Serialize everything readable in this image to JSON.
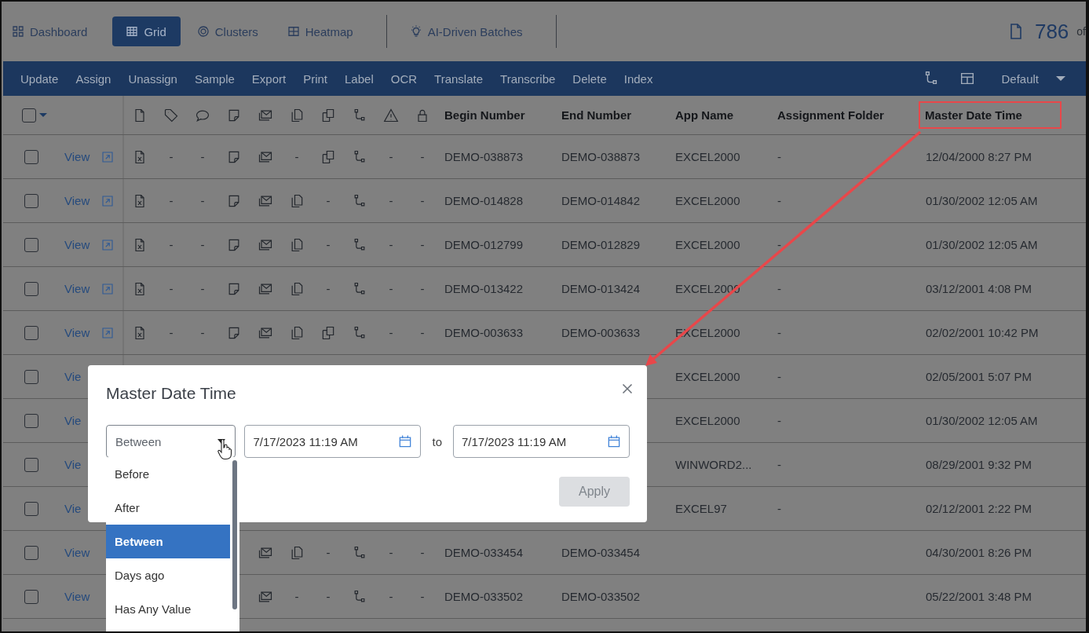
{
  "nav": {
    "tabs": [
      {
        "label": "Dashboard",
        "selected": false
      },
      {
        "label": "Grid",
        "selected": true
      },
      {
        "label": "Clusters",
        "selected": false
      },
      {
        "label": "Heatmap",
        "selected": false
      },
      {
        "label": "AI-Driven Batches",
        "selected": false
      }
    ],
    "doc_count": "786",
    "doc_count_suffix": "of"
  },
  "toolbar": {
    "actions": [
      "Update",
      "Assign",
      "Unassign",
      "Sample",
      "Export",
      "Print",
      "Label",
      "OCR",
      "Translate",
      "Transcribe",
      "Delete",
      "Index"
    ],
    "view": "Default"
  },
  "table": {
    "select_all": {
      "checked": false
    },
    "columns": [
      {
        "label": "Begin Number",
        "highlighted": false
      },
      {
        "label": "End Number",
        "highlighted": false
      },
      {
        "label": "App Name",
        "highlighted": false
      },
      {
        "label": "Assignment Folder",
        "highlighted": false
      },
      {
        "label": "Master Date Time",
        "highlighted": true
      }
    ],
    "rows": [
      {
        "checked": false,
        "view": "View",
        "link": true,
        "icons": [
          {
            "kind": "icon"
          },
          {
            "kind": "text",
            "text": "-"
          },
          {
            "kind": "text",
            "text": "-"
          },
          {
            "kind": "icon"
          },
          {
            "kind": "icon"
          },
          {
            "kind": "text",
            "text": "-"
          },
          {
            "kind": "icon"
          },
          {
            "kind": "icon"
          },
          {
            "kind": "text",
            "text": "-"
          },
          {
            "kind": "text",
            "text": "-"
          }
        ],
        "cells": [
          "DEMO-038873",
          "DEMO-038873",
          "EXCEL2000",
          "-",
          "12/04/2000 8:27 PM"
        ]
      },
      {
        "checked": false,
        "view": "View",
        "link": true,
        "icons": [
          {
            "kind": "icon"
          },
          {
            "kind": "text",
            "text": "-"
          },
          {
            "kind": "text",
            "text": "-"
          },
          {
            "kind": "icon"
          },
          {
            "kind": "icon"
          },
          {
            "kind": "icon"
          },
          {
            "kind": "text",
            "text": "-"
          },
          {
            "kind": "icon"
          },
          {
            "kind": "text",
            "text": "-"
          },
          {
            "kind": "text",
            "text": "-"
          }
        ],
        "cells": [
          "DEMO-014828",
          "DEMO-014842",
          "EXCEL2000",
          "-",
          "01/30/2002 12:05 AM"
        ]
      },
      {
        "checked": false,
        "view": "View",
        "link": true,
        "icons": [
          {
            "kind": "icon"
          },
          {
            "kind": "text",
            "text": "-"
          },
          {
            "kind": "text",
            "text": "-"
          },
          {
            "kind": "icon"
          },
          {
            "kind": "icon"
          },
          {
            "kind": "icon"
          },
          {
            "kind": "text",
            "text": "-"
          },
          {
            "kind": "icon"
          },
          {
            "kind": "text",
            "text": "-"
          },
          {
            "kind": "text",
            "text": "-"
          }
        ],
        "cells": [
          "DEMO-012799",
          "DEMO-012829",
          "EXCEL2000",
          "-",
          "01/30/2002 12:05 AM"
        ]
      },
      {
        "checked": false,
        "view": "View",
        "link": true,
        "icons": [
          {
            "kind": "icon"
          },
          {
            "kind": "text",
            "text": "-"
          },
          {
            "kind": "text",
            "text": "-"
          },
          {
            "kind": "icon"
          },
          {
            "kind": "icon"
          },
          {
            "kind": "icon"
          },
          {
            "kind": "text",
            "text": "-"
          },
          {
            "kind": "icon"
          },
          {
            "kind": "text",
            "text": "-"
          },
          {
            "kind": "text",
            "text": "-"
          }
        ],
        "cells": [
          "DEMO-013422",
          "DEMO-013424",
          "EXCEL2000",
          "-",
          "03/12/2001 4:08 PM"
        ]
      },
      {
        "checked": false,
        "view": "View",
        "link": true,
        "icons": [
          {
            "kind": "icon"
          },
          {
            "kind": "text",
            "text": "-"
          },
          {
            "kind": "text",
            "text": "-"
          },
          {
            "kind": "icon"
          },
          {
            "kind": "icon"
          },
          {
            "kind": "icon"
          },
          {
            "kind": "icon"
          },
          {
            "kind": "icon"
          },
          {
            "kind": "text",
            "text": "-"
          },
          {
            "kind": "text",
            "text": "-"
          }
        ],
        "cells": [
          "DEMO-003633",
          "DEMO-003633",
          "EXCEL2000",
          "-",
          "02/02/2001 10:42 PM"
        ]
      },
      {
        "checked": false,
        "view": "Vie",
        "icons": [],
        "cells": [
          null,
          null,
          "EXCEL2000",
          "-",
          "02/05/2001 5:07 PM"
        ]
      },
      {
        "checked": false,
        "view": "Vie",
        "icons": [],
        "cells": [
          null,
          null,
          "EXCEL2000",
          "-",
          "01/30/2002 12:05 AM"
        ]
      },
      {
        "checked": false,
        "view": "Vie",
        "icons": [],
        "cells": [
          null,
          null,
          "WINWORD2...",
          "-",
          "08/29/2001 9:32 PM"
        ]
      },
      {
        "checked": false,
        "view": "Vie",
        "icons": [],
        "cells": [
          null,
          null,
          "EXCEL97",
          "-",
          "02/12/2001 2:22 PM"
        ]
      },
      {
        "checked": false,
        "view": "View",
        "icons": [
          {
            "kind": "covered"
          },
          {
            "kind": "covered"
          },
          {
            "kind": "covered"
          },
          {
            "kind": "covered"
          },
          {
            "kind": "icon"
          },
          {
            "kind": "icon"
          },
          {
            "kind": "text",
            "text": "-"
          },
          {
            "kind": "icon"
          },
          {
            "kind": "text",
            "text": "-"
          },
          {
            "kind": "text",
            "text": "-"
          }
        ],
        "cells": [
          "DEMO-033454",
          "DEMO-033454",
          null,
          null,
          "04/30/2001 8:26 PM"
        ]
      },
      {
        "checked": false,
        "view": "View",
        "icons": [
          {
            "kind": "covered"
          },
          {
            "kind": "covered"
          },
          {
            "kind": "covered"
          },
          {
            "kind": "covered"
          },
          {
            "kind": "icon"
          },
          {
            "kind": "text",
            "text": "-"
          },
          {
            "kind": "text",
            "text": "-"
          },
          {
            "kind": "icon"
          },
          {
            "kind": "text",
            "text": "-"
          },
          {
            "kind": "text",
            "text": "-"
          }
        ],
        "cells": [
          "DEMO-033502",
          "DEMO-033502",
          null,
          null,
          "05/22/2001 3:48 PM"
        ]
      }
    ]
  },
  "dialog": {
    "title": "Master Date Time",
    "operator": {
      "value": "Between",
      "expanded": true
    },
    "from": "7/17/2023 11:19 AM",
    "to_label": "to",
    "to": "7/17/2023 11:19 AM",
    "apply": {
      "label": "Apply",
      "disabled": true
    },
    "options": [
      {
        "label": "Before",
        "selected": false
      },
      {
        "label": "After",
        "selected": false
      },
      {
        "label": "Between",
        "selected": true
      },
      {
        "label": "Days ago",
        "selected": false
      },
      {
        "label": "Has Any Value",
        "selected": false
      }
    ]
  }
}
